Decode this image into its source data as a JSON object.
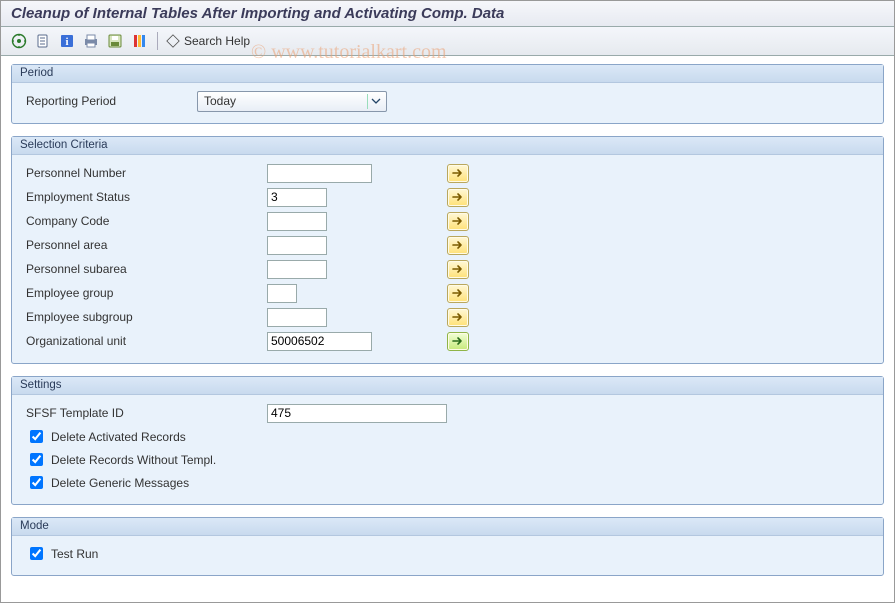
{
  "title": "Cleanup of Internal Tables After Importing and Activating Comp. Data",
  "watermark": "© www.tutorialkart.com",
  "toolbar": {
    "search_help_label": "Search Help"
  },
  "period": {
    "group_title": "Period",
    "reporting_label": "Reporting Period",
    "reporting_value": "Today"
  },
  "selection": {
    "group_title": "Selection Criteria",
    "rows": [
      {
        "id": "personnel_number",
        "label": "Personnel Number",
        "value": "",
        "width": "w-wide"
      },
      {
        "id": "employment_status",
        "label": "Employment Status",
        "value": "3",
        "width": ""
      },
      {
        "id": "company_code",
        "label": "Company Code",
        "value": "",
        "width": ""
      },
      {
        "id": "personnel_area",
        "label": "Personnel area",
        "value": "",
        "width": ""
      },
      {
        "id": "personnel_subarea",
        "label": "Personnel subarea",
        "value": "",
        "width": ""
      },
      {
        "id": "employee_group",
        "label": "Employee group",
        "value": "",
        "width": "w-tiny"
      },
      {
        "id": "employee_subgroup",
        "label": "Employee subgroup",
        "value": "",
        "width": ""
      },
      {
        "id": "org_unit",
        "label": "Organizational unit",
        "value": "50006502",
        "width": "w-wide",
        "green": true
      }
    ]
  },
  "settings": {
    "group_title": "Settings",
    "template_label": "SFSF Template ID",
    "template_value": "475",
    "opts": [
      {
        "id": "del_activated",
        "label": "Delete Activated Records",
        "checked": true
      },
      {
        "id": "del_no_templ",
        "label": "Delete Records Without Templ.",
        "checked": true
      },
      {
        "id": "del_gen_msg",
        "label": "Delete Generic Messages",
        "checked": true
      }
    ]
  },
  "mode": {
    "group_title": "Mode",
    "test_run_label": "Test Run",
    "test_run_checked": true
  }
}
